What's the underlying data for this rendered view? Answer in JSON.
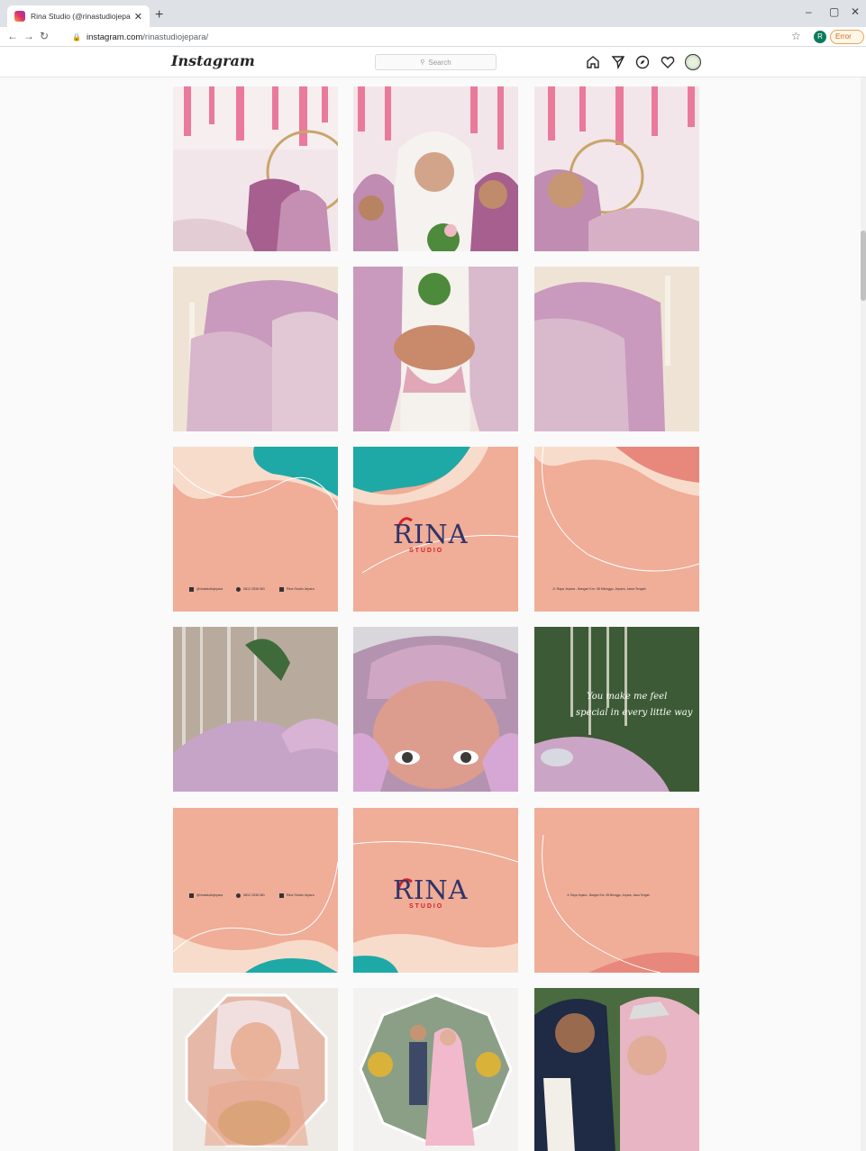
{
  "browser": {
    "tab_title": "Rina Studio (@rinastudiojepara) · I",
    "url_host": "instagram.com",
    "url_path": "/rinastudiojepara/",
    "profile_initial": "R",
    "error_label": "Error"
  },
  "instagram": {
    "logo": "Instagram",
    "search_placeholder": "Search",
    "nav_icons": [
      "home-icon",
      "direct-icon",
      "explore-icon",
      "activity-icon",
      "profile-avatar"
    ]
  },
  "posts": {
    "brand_name": "RINA",
    "brand_sub": "S T U D I O",
    "contact_instagram": "@rinastudiojepara",
    "contact_whatsapp": "0812 2538 081",
    "contact_facebook": "Rina Studio Jepara",
    "address": "Jl. Raya Jepara - Bangsri Km. 08 Mlonggo, Jepara, Jawa Tengah",
    "quote_line1": "You make me feel",
    "quote_line2": "special in every little way"
  },
  "colors": {
    "peach": "#f0ad98",
    "teal": "#1fa9a6",
    "cream": "#f8dccb",
    "pink": "#e9a2bc",
    "lavender": "#c9a3c1"
  }
}
